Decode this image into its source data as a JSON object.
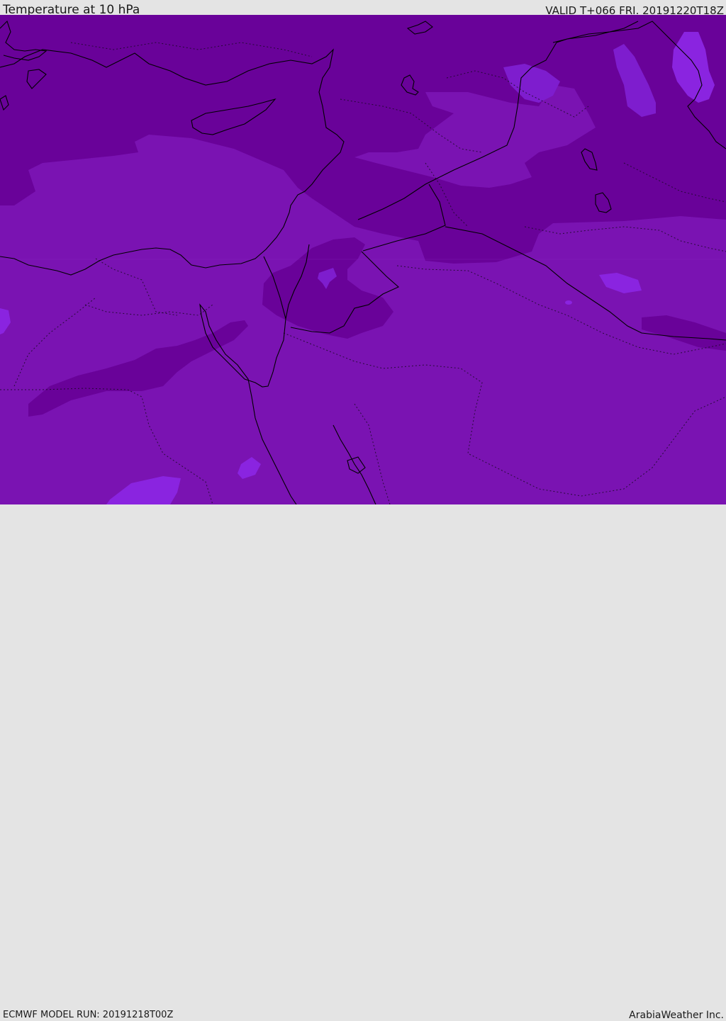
{
  "header": {
    "title": "Temperature at 10 hPa",
    "valid": "VALID T+066 FRI. 20191220T18Z"
  },
  "footer": {
    "model_run": "ECMWF MODEL RUN: 20191218T00Z",
    "credit": "ArabiaWeather Inc."
  },
  "colors": {
    "cold_contour": "#690299",
    "mid_contour": "#7a13b2",
    "warm_contour": "#7e1dce",
    "warmest_contour": "#8a24e0",
    "coastline": "#000000",
    "background_bar": "#e4e4e4"
  },
  "map": {
    "field": "temperature-10hPa",
    "region": "middle-east",
    "layers": [
      "temperature-contours",
      "coastlines",
      "country-borders"
    ]
  }
}
